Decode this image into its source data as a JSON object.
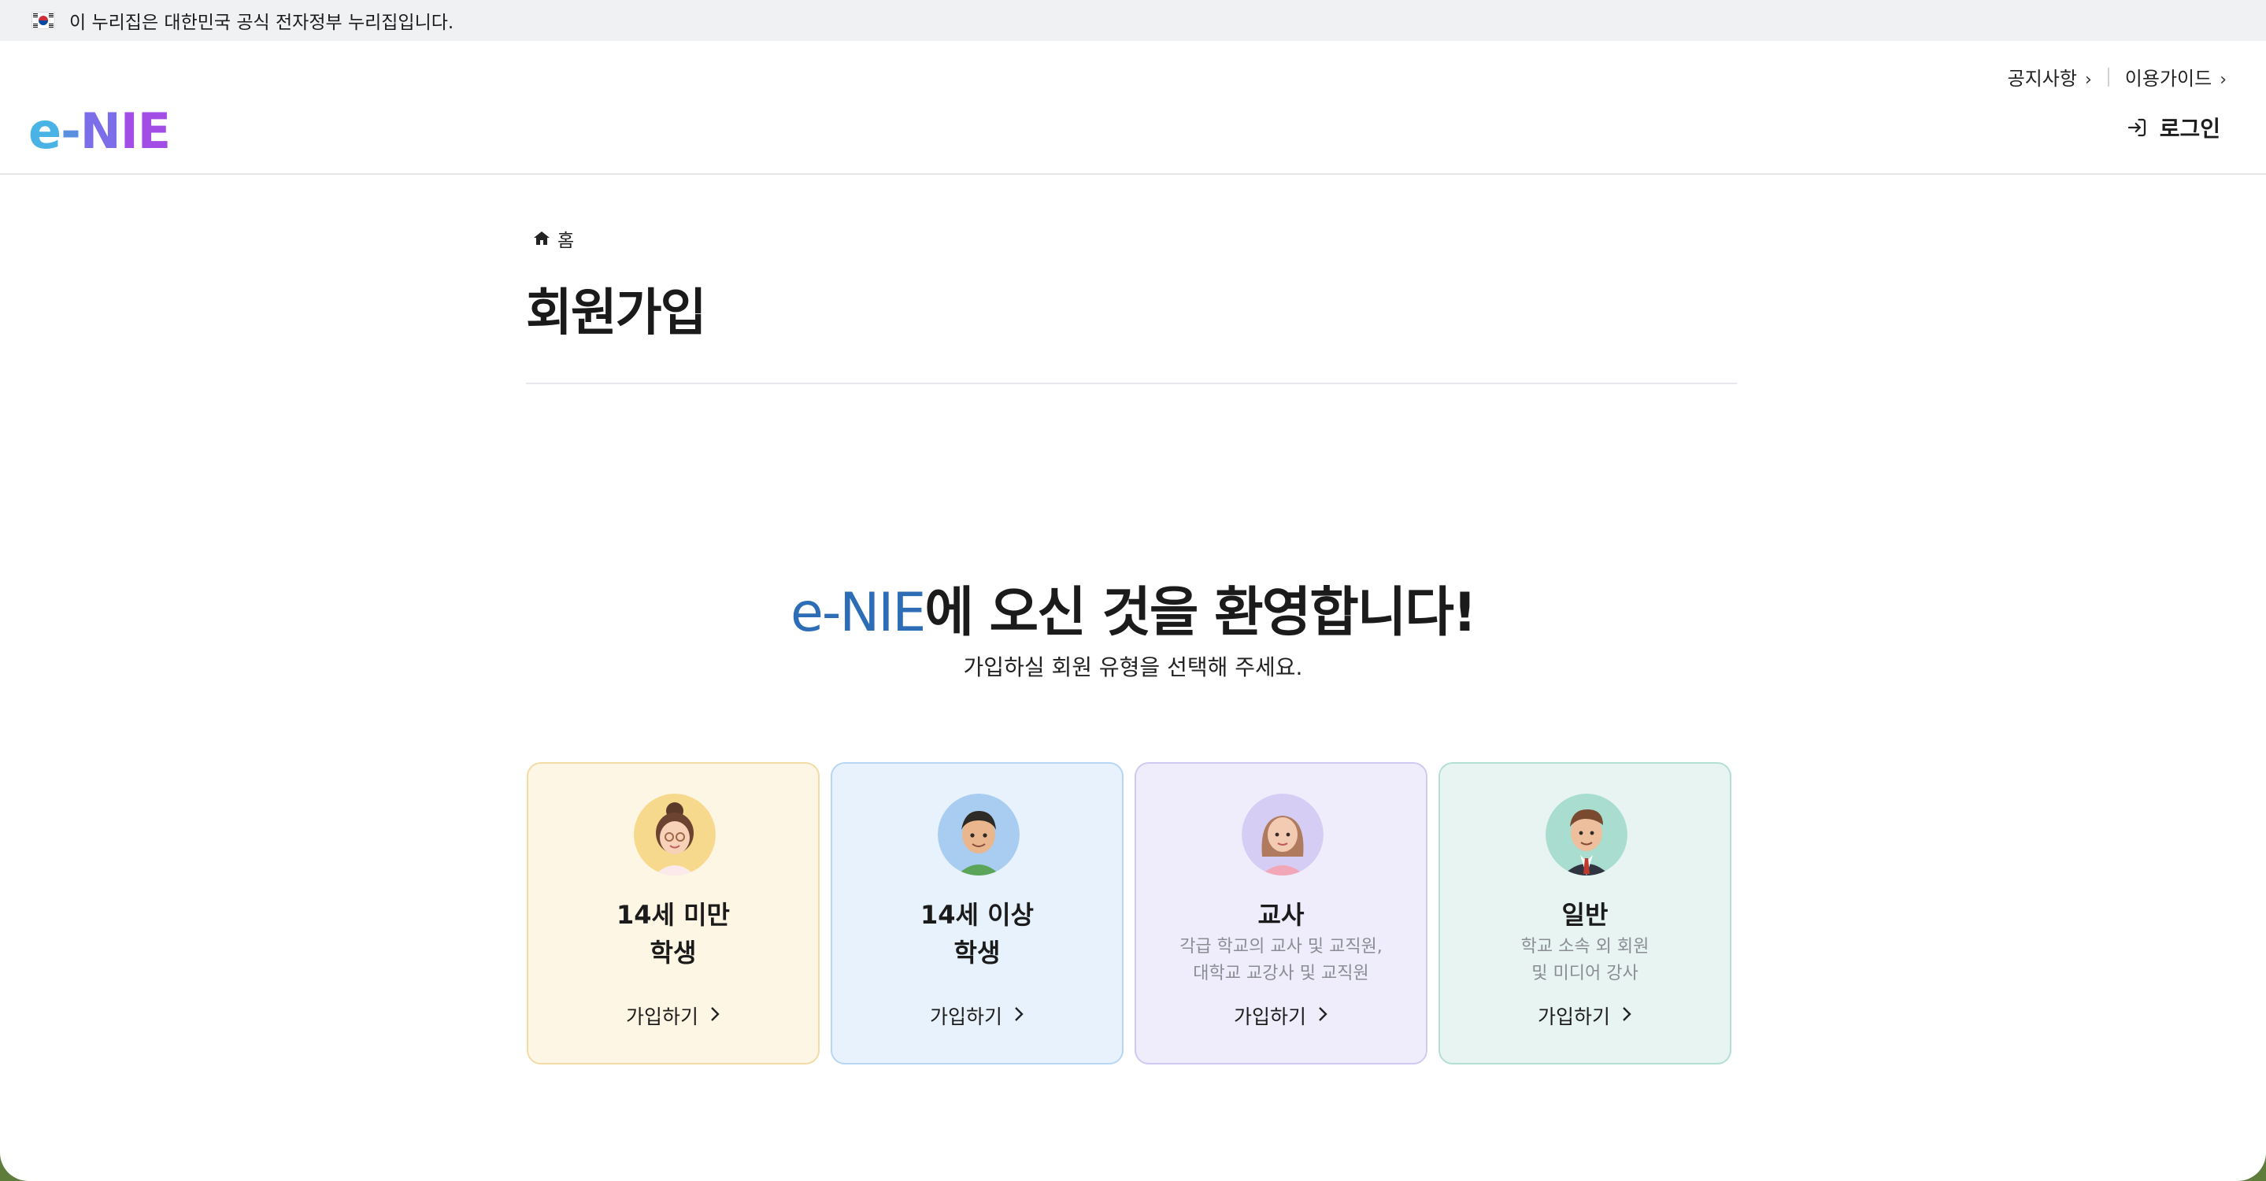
{
  "gov_banner": {
    "text": "이 누리집은 대한민국 공식 전자정부 누리집입니다."
  },
  "header": {
    "logo_parts": {
      "e": "e",
      "dash": "-",
      "n": "N",
      "ie": "IE"
    },
    "util_links": [
      {
        "label": "공지사항"
      },
      {
        "label": "이용가이드"
      }
    ],
    "login_label": "로그인"
  },
  "breadcrumb": {
    "home": "홈"
  },
  "page_title": "회원가입",
  "welcome": {
    "brand": "e-NIE",
    "rest": "에 오신 것을 환영합니다!",
    "subtitle": "가입하실 회원 유형을 선택해 주세요."
  },
  "cards": [
    {
      "title_line1": "14세 미만",
      "title_line2": "학생",
      "desc_line1": "",
      "desc_line2": "",
      "button": "가입하기",
      "avatar_bg": "#f6d98c"
    },
    {
      "title_line1": "14세 이상",
      "title_line2": "학생",
      "desc_line1": "",
      "desc_line2": "",
      "button": "가입하기",
      "avatar_bg": "#a9cdf0"
    },
    {
      "title_line1": "교사",
      "title_line2": "",
      "desc_line1": "각급 학교의 교사 및 교직원,",
      "desc_line2": "대학교 교강사 및 교직원",
      "button": "가입하기",
      "avatar_bg": "#d6cdf5"
    },
    {
      "title_line1": "일반",
      "title_line2": "",
      "desc_line1": "학교 소속 외 회원",
      "desc_line2": "및 미디어 강사",
      "button": "가입하기",
      "avatar_bg": "#a8ddd0"
    }
  ],
  "colors": {
    "brand_blue": "#2d6db5",
    "card_student_young": "#fdf6e4",
    "card_student": "#e8f2fd",
    "card_teacher": "#efedfc",
    "card_general": "#e7f4f1"
  },
  "icons": [
    "korean-flag-icon",
    "chevron-right-icon",
    "login-icon",
    "home-icon"
  ]
}
